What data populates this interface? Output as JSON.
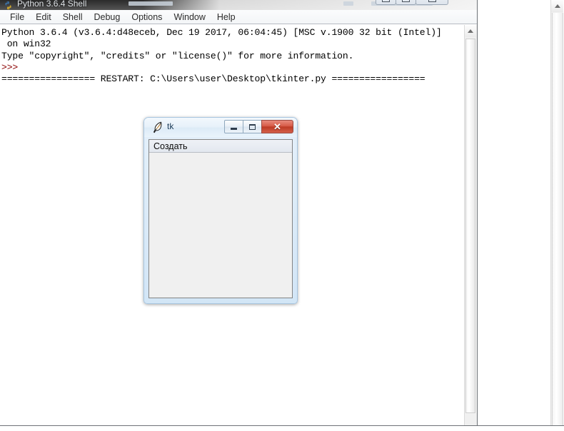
{
  "idle_window": {
    "title": "Python 3.6.4 Shell",
    "icon": "python-logo-icon",
    "menu": [
      {
        "label": "File"
      },
      {
        "label": "Edit"
      },
      {
        "label": "Shell"
      },
      {
        "label": "Debug"
      },
      {
        "label": "Options"
      },
      {
        "label": "Window"
      },
      {
        "label": "Help"
      }
    ],
    "window_buttons": [
      {
        "name": "minimize-button",
        "glyph": "minimize-icon"
      },
      {
        "name": "maximize-button",
        "glyph": "maximize-icon"
      },
      {
        "name": "close-button",
        "glyph": "close-icon"
      }
    ],
    "console_lines": [
      {
        "text": "Python 3.6.4 (v3.6.4:d48eceb, Dec 19 2017, 06:04:45) [MSC v.1900 32 bit (Intel)]",
        "style": "output"
      },
      {
        "text": " on win32",
        "style": "output"
      },
      {
        "text": "Type \"copyright\", \"credits\" or \"license()\" for more information.",
        "style": "output"
      },
      {
        "text": ">>>",
        "style": "prompt"
      },
      {
        "text": "================= RESTART: C:\\Users\\user\\Desktop\\tkinter.py =================",
        "style": "output"
      }
    ]
  },
  "tk_window": {
    "title": "tk",
    "icon": "feather-quill-icon",
    "window_buttons": [
      {
        "name": "minimize-button",
        "glyph": "minimize-icon"
      },
      {
        "name": "maximize-button",
        "glyph": "maximize-icon"
      },
      {
        "name": "close-button",
        "glyph": "close-icon",
        "label": "✕"
      }
    ],
    "create_button_label": "Создать"
  },
  "colors": {
    "prompt_red": "#8b0000",
    "close_button_red": "#bd3a24",
    "aero_blue": "#d0e4f6",
    "window_border": "#6e7277"
  }
}
